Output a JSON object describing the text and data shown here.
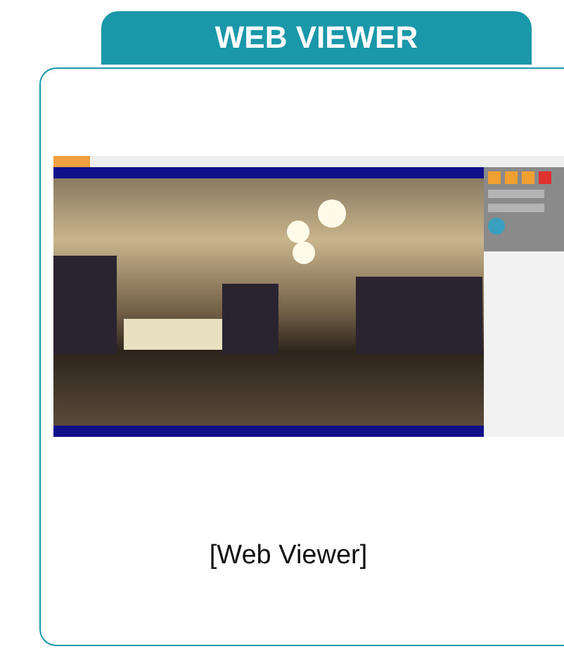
{
  "header": {
    "title": "WEB VIEWER"
  },
  "figure": {
    "caption": "[Web Viewer]"
  }
}
